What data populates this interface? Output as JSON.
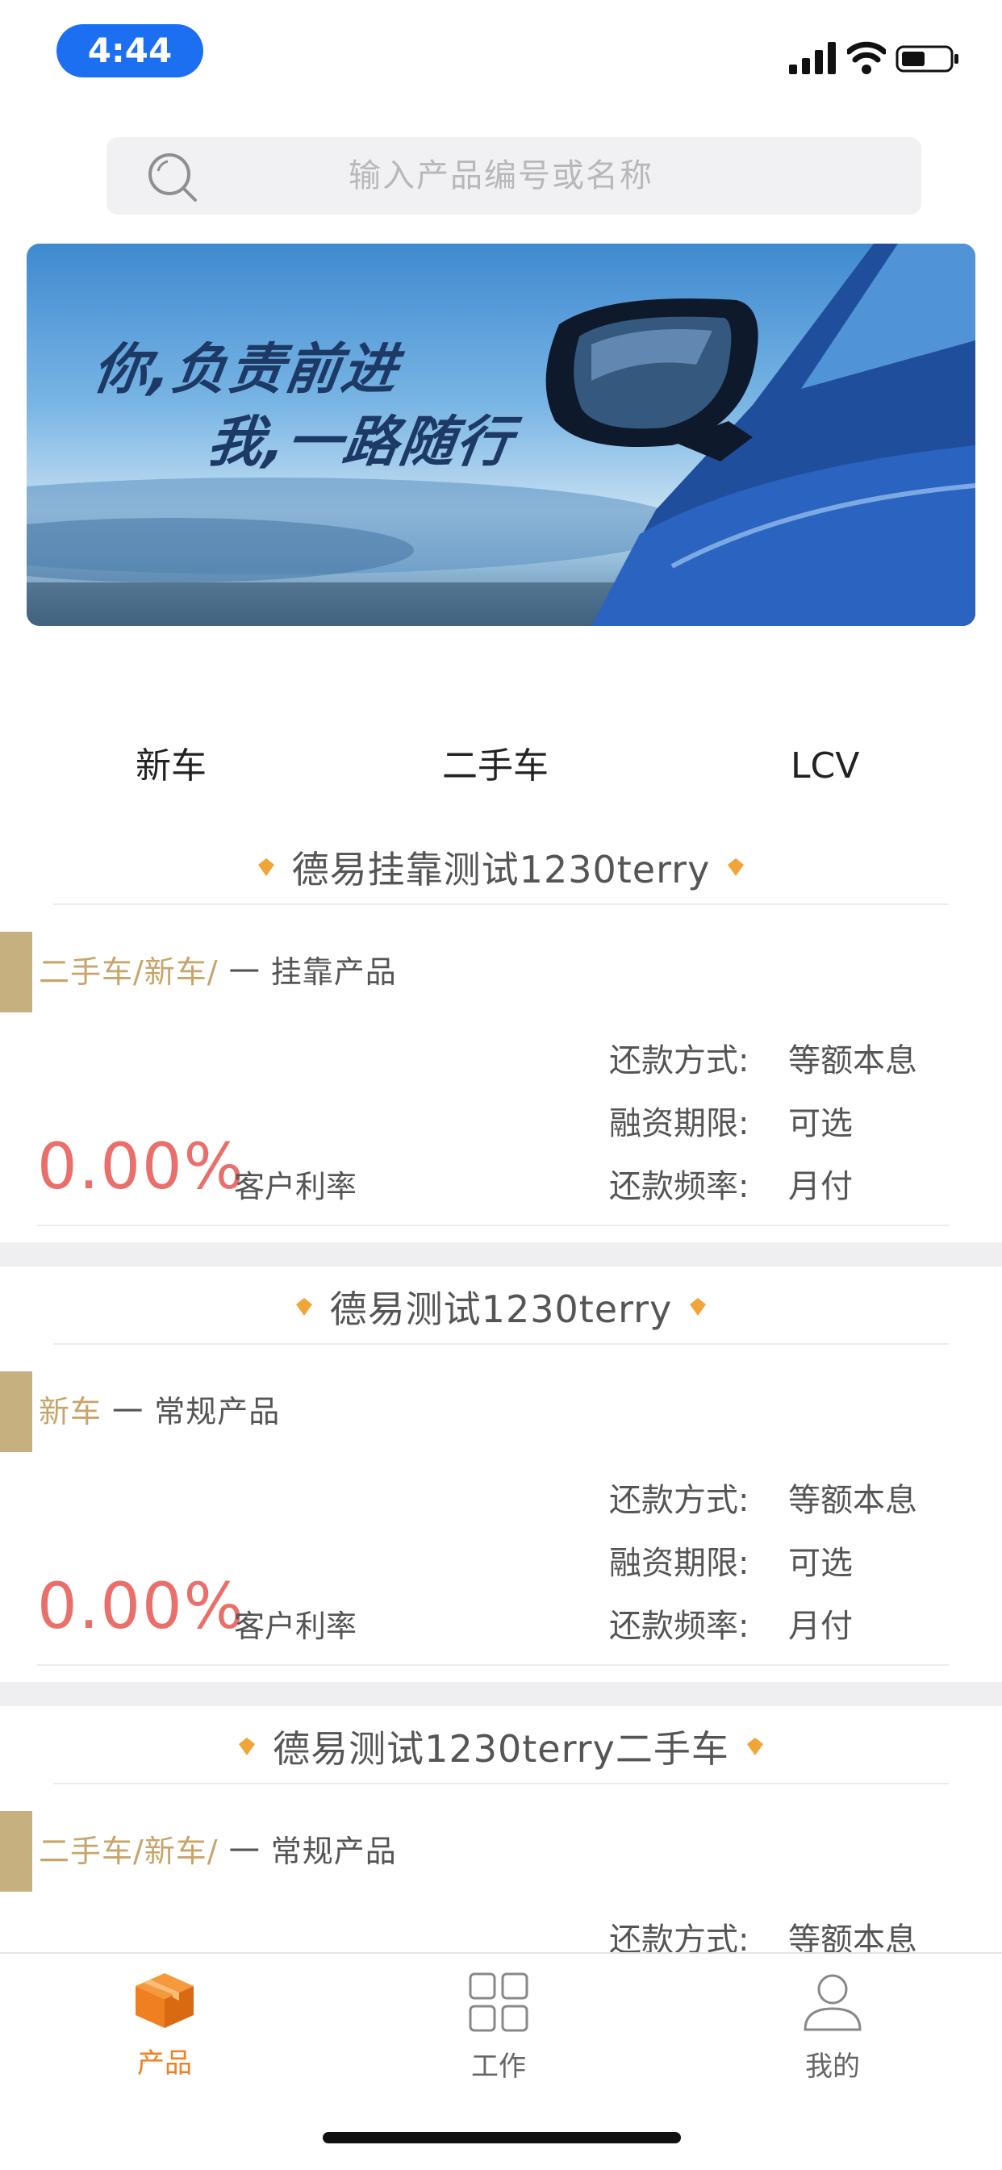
{
  "status_bar": {
    "time": "4:44",
    "icons": [
      "signal-icon",
      "wifi-icon",
      "battery-icon"
    ]
  },
  "search": {
    "placeholder": "输入产品编号或名称",
    "icon": "search-icon"
  },
  "banner": {
    "line1": "你,负责前进",
    "line2": "我,一路随行"
  },
  "categories": [
    "新车",
    "二手车",
    "LCV"
  ],
  "products": [
    {
      "title": "德易挂靠测试1230terry",
      "tag_categories": "二手车/新车/",
      "tag_type": "一 挂靠产品",
      "rate": "0.00%",
      "rate_label": "客户利率",
      "attributes": [
        {
          "label": "还款方式:",
          "value": "等额本息"
        },
        {
          "label": "融资期限:",
          "value": "可选"
        },
        {
          "label": "还款频率:",
          "value": "月付"
        }
      ]
    },
    {
      "title": "德易测试1230terry",
      "tag_categories": "新车",
      "tag_type": "一 常规产品",
      "rate": "0.00%",
      "rate_label": "客户利率",
      "attributes": [
        {
          "label": "还款方式:",
          "value": "等额本息"
        },
        {
          "label": "融资期限:",
          "value": "可选"
        },
        {
          "label": "还款频率:",
          "value": "月付"
        }
      ]
    },
    {
      "title": "德易测试1230terry二手车",
      "tag_categories": "二手车/新车/",
      "tag_type": "一 常规产品",
      "attributes": [
        {
          "label": "还款方式:",
          "value": "等额本息"
        }
      ]
    }
  ],
  "tab_bar": {
    "items": [
      {
        "label": "产品",
        "icon": "box-icon",
        "active": true
      },
      {
        "label": "工作",
        "icon": "grid-icon",
        "active": false
      },
      {
        "label": "我的",
        "icon": "user-icon",
        "active": false
      }
    ]
  },
  "colors": {
    "accent": "#1d6ff2",
    "rate": "#ea6f6b",
    "tag_gold": "#c7a56a",
    "active_tab": "#f07f22",
    "inactive_tab": "#888888"
  }
}
